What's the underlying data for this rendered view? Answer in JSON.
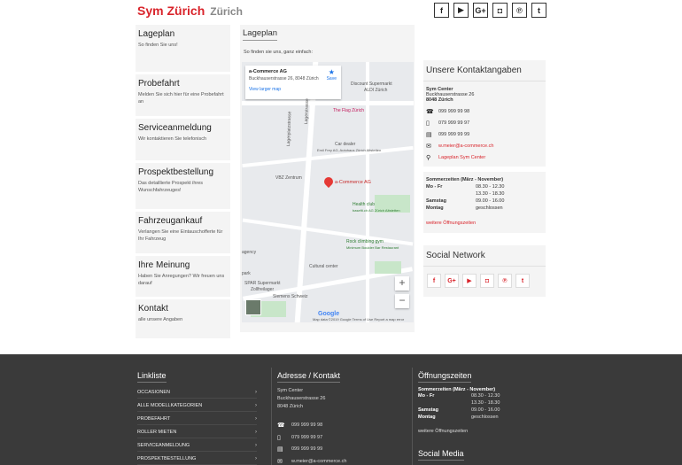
{
  "header": {
    "brand": "Sym Zürich",
    "city": "Zürich",
    "social": [
      {
        "icon": "facebook-icon",
        "glyph": "f"
      },
      {
        "icon": "youtube-icon",
        "glyph": "▶"
      },
      {
        "icon": "googleplus-icon",
        "glyph": "G+"
      },
      {
        "icon": "instagram-icon",
        "glyph": "◘"
      },
      {
        "icon": "pinterest-icon",
        "glyph": "℗"
      },
      {
        "icon": "twitter-icon",
        "glyph": "t"
      }
    ]
  },
  "nav": {
    "items": [
      {
        "title": "Lageplan",
        "sub": "So finden Sie uns!"
      },
      {
        "title": "Probefahrt",
        "sub": "Melden Sie sich hier für eine Probefahrt an"
      },
      {
        "title": "Serviceanmeldung",
        "sub": "Wir kontaktieren Sie telefonisch"
      },
      {
        "title": "Prospektbestellung",
        "sub": "Das detaillierte Prospekt ihres Wunschfahrzeuges!"
      },
      {
        "title": "Fahrzeugankauf",
        "sub": "Verlangen Sie eine Eintauschofferte für Ihr Fahrzeug"
      },
      {
        "title": "Ihre Meinung",
        "sub": "Haben Sie Anregungen? Wir freuen uns darauf"
      },
      {
        "title": "Kontakt",
        "sub": "alle unsere Angaben"
      }
    ]
  },
  "center": {
    "title": "Lageplan",
    "intro": "So finden sie uns, ganz einfach:",
    "map": {
      "place_name": "a-Commerce AG",
      "place_address": "Buckhauserstrasse 26, 8048 Zürich",
      "view_larger": "View larger map",
      "save": "Save",
      "pin_label": "a-Commerce AG",
      "labels": {
        "discount": "Discount Supermarkt",
        "discount_sub": "ALDI Zürich",
        "flag": "The Flag Zürich",
        "car": "Car dealer",
        "car_sub": "Emil Frey AG, Autohaus Zürich Altstetten",
        "vbz": "VBZ Zentrum",
        "health": "Health club",
        "health_sub": "basefit.ch AG Zürich Altstetten",
        "rock": "Rock climbing gym",
        "rock_sub": "Minimum Boulder Bar Restaurant",
        "cultural": "Cultural center",
        "spar": "SPAR Supermarkt",
        "spar_sub": "Zollfreilager",
        "siemens": "Siemens Schweiz",
        "park": "park",
        "agency": "agency",
        "street1": "Lagerplatzstrasse",
        "street2": "Lagerstrasse"
      },
      "google": "Google",
      "footer": "Map data ©2019 Google   Terms of Use   Report a map error",
      "zoom_in": "+",
      "zoom_out": "−"
    }
  },
  "contact": {
    "title": "Unsere Kontaktangaben",
    "company": "Sym Center",
    "street": "Buckhauserstrasse 26",
    "zip": "8048",
    "city": "Zürich",
    "rows": [
      {
        "icon": "phone-icon",
        "glyph": "☎",
        "value": "099 999 99 98",
        "red": false
      },
      {
        "icon": "mobile-icon",
        "glyph": "▯",
        "value": "079 999 99 97",
        "red": false
      },
      {
        "icon": "fax-icon",
        "glyph": "▤",
        "value": "099 999 99 99",
        "red": false
      },
      {
        "icon": "email-icon",
        "glyph": "✉",
        "value": "w.meier@a-commerce.ch",
        "red": true
      },
      {
        "icon": "location-icon",
        "glyph": "⚲",
        "value": "Lageplan Sym Center",
        "red": true
      }
    ],
    "hours_title": "Sommerzeiten  (März - November)",
    "hours": [
      {
        "k": "Mo - Fr",
        "v": "08.30 - 12.30"
      },
      {
        "k": "",
        "v": "13.30 - 18.30"
      },
      {
        "k": "Samstag",
        "v": "09.00 - 16.00"
      },
      {
        "k": "Montag",
        "v": "geschlossen"
      }
    ],
    "more_hours": "weitere Öffnungszeiten"
  },
  "social_network": {
    "title": "Social Network",
    "buttons": [
      {
        "icon": "facebook-icon",
        "glyph": "f"
      },
      {
        "icon": "googleplus-icon",
        "glyph": "G+"
      },
      {
        "icon": "youtube-icon",
        "glyph": "▶"
      },
      {
        "icon": "instagram-icon",
        "glyph": "◘"
      },
      {
        "icon": "pinterest-icon",
        "glyph": "℗"
      },
      {
        "icon": "twitter-icon",
        "glyph": "t"
      }
    ]
  },
  "footer": {
    "links_title": "Linkliste",
    "links": [
      "OCCASIONEN",
      "ALLE MODELLKATEGORIEN",
      "PROBEFAHRT",
      "ROLLER MIETEN",
      "SERVICEANMELDUNG",
      "PROSPEKTBESTELLUNG"
    ],
    "address_title": "Adresse / Kontakt",
    "company": "Sym Center",
    "street": "Buckhauserstrasse 26",
    "zipcity": "8048  Zürich",
    "rows": [
      {
        "icon": "phone-icon",
        "glyph": "☎",
        "value": "099 999 99 98"
      },
      {
        "icon": "mobile-icon",
        "glyph": "▯",
        "value": "079 999 99 97"
      },
      {
        "icon": "fax-icon",
        "glyph": "▤",
        "value": "099 999 99 99"
      },
      {
        "icon": "email-icon",
        "glyph": "✉",
        "value": "w.meier@a-commerce.ch"
      }
    ],
    "hours_title": "Öffnungszeiten",
    "hours_header": "Sommerzeiten  (März - November)",
    "hours": [
      {
        "k": "Mo - Fr",
        "v": "08.30 - 12.30"
      },
      {
        "k": "",
        "v": "13.30 - 18.30"
      },
      {
        "k": "Samstag",
        "v": "09.00 - 16.00"
      },
      {
        "k": "Montag",
        "v": "geschlossen"
      }
    ],
    "more_hours": "weitere Öffnungszeiten",
    "social_title": "Social Media"
  }
}
